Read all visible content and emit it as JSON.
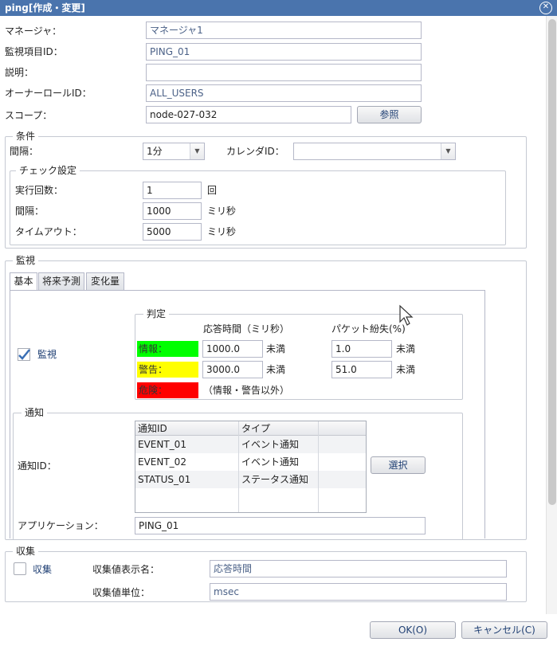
{
  "window": {
    "title": "ping[作成・変更]"
  },
  "form": {
    "manager": {
      "label": "マネージャ：",
      "value": "マネージャ1"
    },
    "monitor_id": {
      "label": "監視項目ID：",
      "value": "PING_01"
    },
    "description": {
      "label": "説明：",
      "value": ""
    },
    "owner_role": {
      "label": "オーナーロールID：",
      "value": "ALL_USERS"
    },
    "scope": {
      "label": "スコープ：",
      "value": "node-027-032",
      "button": "参照"
    }
  },
  "conditions": {
    "legend": "条件",
    "interval_label": "間隔：",
    "interval_value": "1分",
    "calendar_label": "カレンダID：",
    "calendar_value": "",
    "check": {
      "legend": "チェック設定",
      "runs_label": "実行回数：",
      "runs_value": "1",
      "runs_unit": "回",
      "interval_label": "間隔：",
      "interval_value": "1000",
      "interval_unit": "ミリ秒",
      "timeout_label": "タイムアウト：",
      "timeout_value": "5000",
      "timeout_unit": "ミリ秒"
    }
  },
  "monitor": {
    "legend": "監視",
    "tabs": [
      "基本",
      "将来予測",
      "変化量"
    ],
    "checkbox_label": "監視",
    "judgement": {
      "legend": "判定",
      "col_response": "応答時間（ミリ秒）",
      "col_packet": "パケット紛失(%)",
      "info_label": "情報：",
      "info_color": "#00ff00",
      "warn_label": "警告：",
      "warn_color": "#ffff00",
      "crit_label": "危険：",
      "crit_color": "#ff0000",
      "info_response": "1000.0",
      "info_packet": "1.0",
      "warn_response": "3000.0",
      "warn_packet": "51.0",
      "less_than": "未満",
      "other_note": "（情報・警告以外）"
    },
    "notify": {
      "legend": "通知",
      "id_label": "通知ID：",
      "columns": [
        "通知ID",
        "タイプ"
      ],
      "rows": [
        {
          "id": "EVENT_01",
          "type": "イベント通知"
        },
        {
          "id": "EVENT_02",
          "type": "イベント通知"
        },
        {
          "id": "STATUS_01",
          "type": "ステータス通知"
        }
      ],
      "select_button": "選択",
      "app_label": "アプリケーション：",
      "app_value": "PING_01"
    }
  },
  "collect": {
    "legend": "収集",
    "checkbox_label": "収集",
    "display_name_label": "収集値表示名：",
    "display_name_value": "応答時間",
    "unit_label": "収集値単位：",
    "unit_value": "msec"
  },
  "buttons": {
    "ok": "OK(O)",
    "cancel": "キャンセル(C)"
  }
}
